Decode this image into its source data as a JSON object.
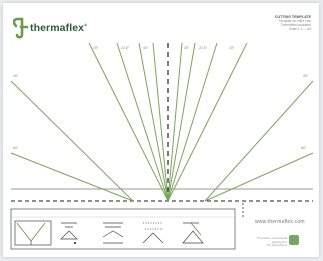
{
  "brand": {
    "name": "thermaflex",
    "reg_mark": "®",
    "color": "#6a9a4a",
    "url": "www.thermaflex.com"
  },
  "title_block": {
    "heading": "CUTTING TEMPLATE",
    "line1": "Template for mitre cuts",
    "line2": "Thermaflex insulation",
    "line3": "Scale 1:1 — A4"
  },
  "angle_labels": {
    "top_left": "15°",
    "top_mid_left": "22.5°",
    "top_center_left": "30°",
    "top_center_right": "30°",
    "top_mid_right": "22.5°",
    "top_right": "15°",
    "side_left_upper": "45°",
    "side_left_lower": "60°",
    "side_right_upper": "45°",
    "side_right_lower": "60°"
  },
  "icons": [
    "v-cut-icon",
    "corner-joint-icon",
    "tee-joint-icon",
    "dotted-mitre-icon",
    "angled-cut-icon"
  ],
  "footer": {
    "line1": "Thermaflex International",
    "line2": "Holding B.V.",
    "line3": "The Netherlands"
  },
  "colors": {
    "guide_lines": "#7ba55a",
    "dashed": "#222222",
    "frame": "#333333"
  }
}
